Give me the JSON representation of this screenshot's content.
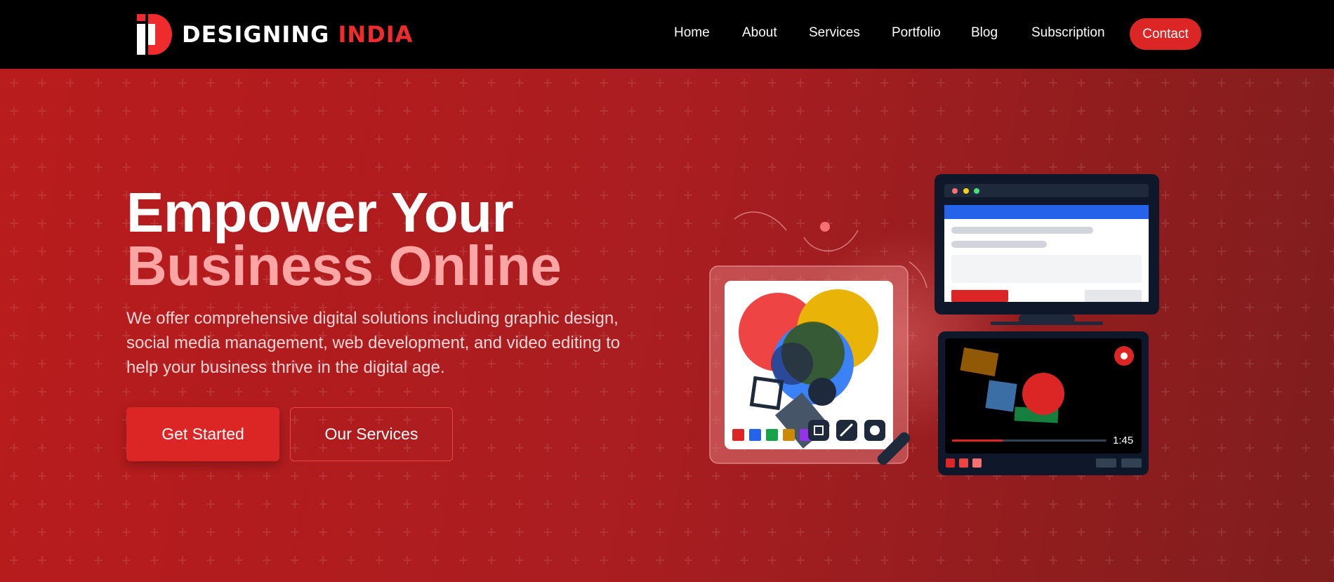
{
  "brand": {
    "name_primary": "DESIGNING",
    "name_accent": "INDIA"
  },
  "nav": {
    "links": [
      {
        "label": "Home"
      },
      {
        "label": "About"
      },
      {
        "label": "Services"
      },
      {
        "label": "Portfolio"
      },
      {
        "label": "Blog"
      },
      {
        "label": "Subscription"
      }
    ],
    "contact_label": "Contact"
  },
  "hero": {
    "headline_line1": "Empower Your",
    "headline_line2": "Business Online",
    "subtext": "We offer comprehensive digital solutions including graphic design, social media management, web development, and video editing to help your business thrive in the digital age.",
    "primary_cta": "Get Started",
    "secondary_cta": "Our Services"
  },
  "illustration": {
    "video_time": "1:45",
    "video_progress": 0.33
  },
  "colors": {
    "nav_bg": "#000000",
    "accent": "#dc2626",
    "hero_bg_start": "#b91c1c",
    "hero_bg_end": "#7f1d1d",
    "headline_highlight": "#fca5a5"
  }
}
